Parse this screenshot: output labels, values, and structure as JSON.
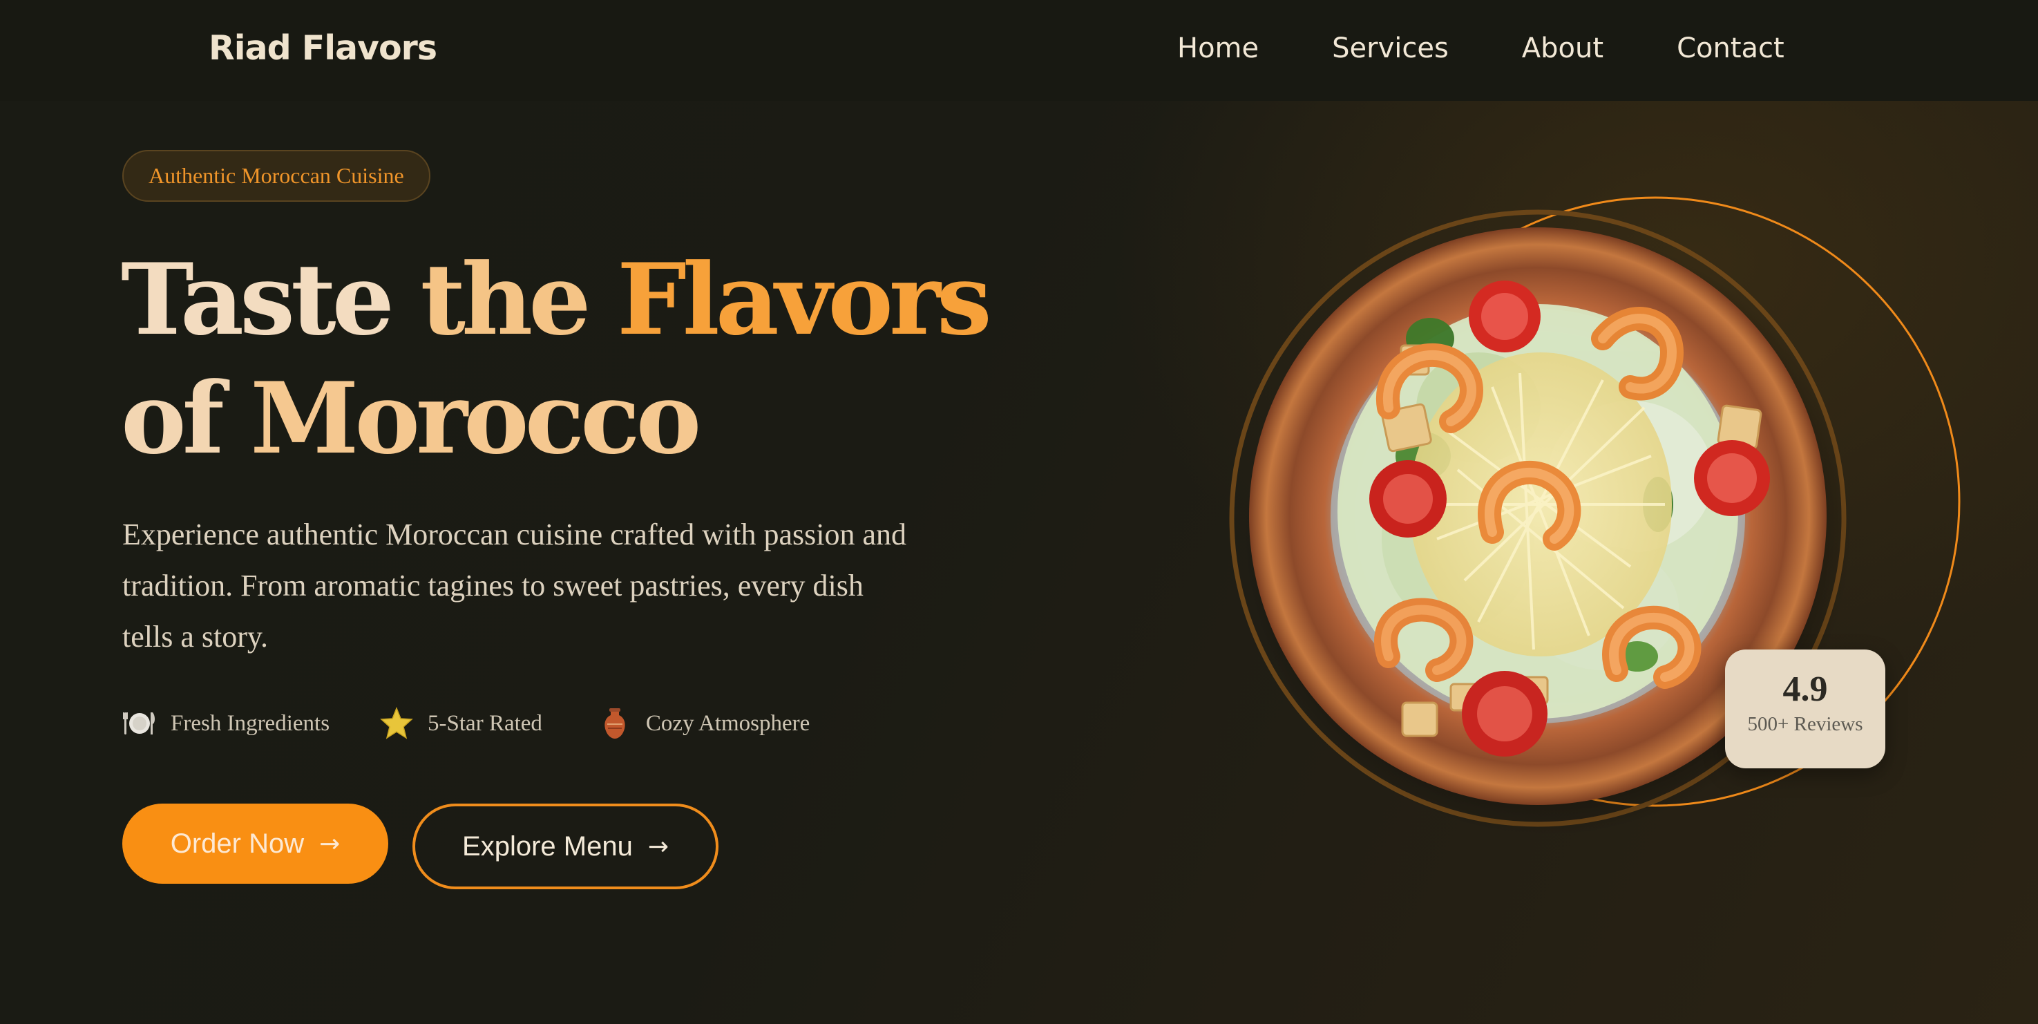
{
  "brand": {
    "name": "Riad Flavors"
  },
  "nav": {
    "items": [
      {
        "label": "Home"
      },
      {
        "label": "Services"
      },
      {
        "label": "About"
      },
      {
        "label": "Contact"
      }
    ]
  },
  "hero": {
    "badge": "Authentic Moroccan Cuisine",
    "headline": {
      "line1": [
        "Taste",
        "the",
        "Flavors"
      ],
      "line2": [
        "of",
        "Morocco"
      ]
    },
    "description": "Experience authentic Moroccan cuisine crafted with passion and tradition. From aromatic tagines to sweet pastries, every dish tells a story.",
    "features": [
      {
        "icon": "plate-cutlery-icon",
        "label": "Fresh Ingredients"
      },
      {
        "icon": "star-icon",
        "label": "5-Star Rated"
      },
      {
        "icon": "vase-icon",
        "label": "Cozy Atmosphere"
      }
    ],
    "primary_button": {
      "label": "Order Now",
      "arrow": "→"
    },
    "secondary_button": {
      "label": "Explore Menu",
      "arrow": "→"
    }
  },
  "rating": {
    "value": "4.9",
    "label": "500+ Reviews"
  },
  "colors": {
    "accent": "#f98f13",
    "background": "#1a1b14",
    "cream": "#e7dac5"
  }
}
